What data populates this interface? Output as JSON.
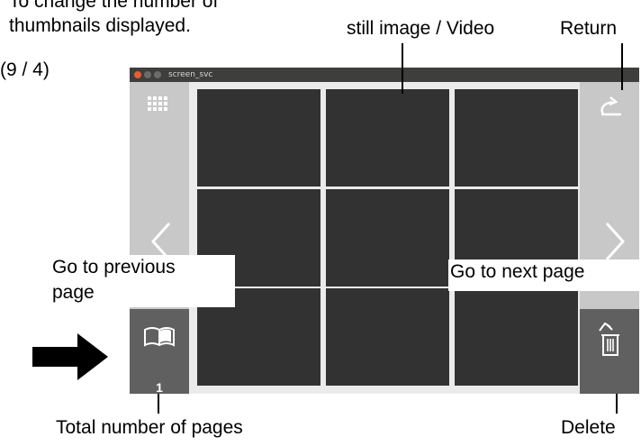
{
  "window": {
    "title": "screen_svc"
  },
  "annotations": {
    "change_thumbnails_line1": "To change the number of",
    "change_thumbnails_line2": "thumbnails displayed.",
    "change_thumbnails_line3": "(9 / 4)",
    "still_video": "still image / Video",
    "return": "Return",
    "prev_page_line1": "Go to previous",
    "prev_page_line2": "page",
    "next_page": "Go to next page",
    "total_pages": "Total number of pages",
    "delete": "Delete"
  },
  "sidebar": {
    "page_count": "1"
  },
  "thumbnails": {
    "count": 9
  },
  "icons": {
    "grid": "grid-icon",
    "return": "return-icon",
    "prev": "chevron-left-icon",
    "next": "chevron-right-icon",
    "book": "book-icon",
    "delete": "trash-icon",
    "arrow": "arrow-right-icon"
  },
  "colors": {
    "titlebar": "#3e3e3c",
    "close_button": "#e25e35",
    "thumbnail": "#323232",
    "sidebar": "#c8c8c8",
    "sidebar_dark": "#606060"
  }
}
